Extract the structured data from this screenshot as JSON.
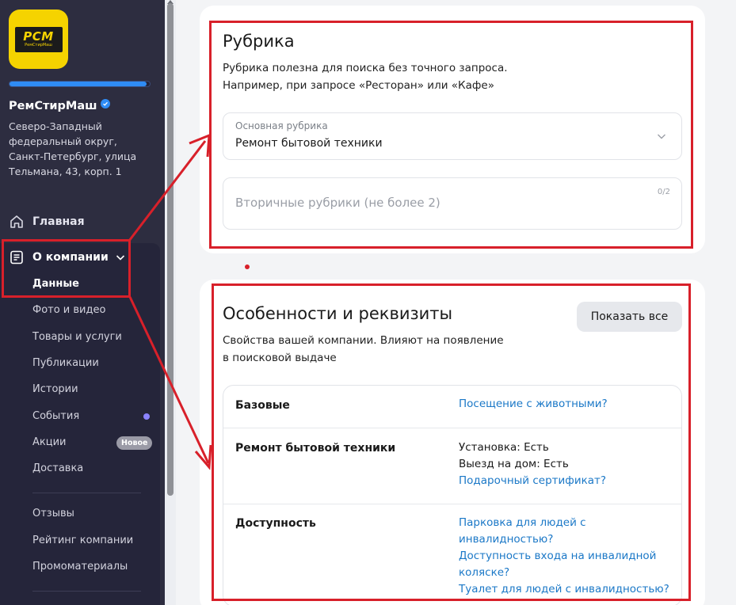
{
  "sidebar": {
    "logo": {
      "main": "РСМ",
      "sub": "РемСтирМаш"
    },
    "profile_progress": 0.98,
    "company_name": "РемСтирМаш",
    "address": "Северо-Западный федеральный округ, Санкт-Петербург, улица Тельмана, 43, корп. 1",
    "nav_main": "Главная",
    "nav_about": "О компании",
    "items": [
      {
        "label": "Данные"
      },
      {
        "label": "Фото и видео"
      },
      {
        "label": "Товары и услуги"
      },
      {
        "label": "Публикации"
      },
      {
        "label": "Истории"
      },
      {
        "label": "События"
      },
      {
        "label": "Акции"
      },
      {
        "label": "Доставка"
      },
      {
        "label": "Отзывы"
      },
      {
        "label": "Рейтинг компании"
      },
      {
        "label": "Промоматериалы"
      }
    ],
    "badge_new": "Новое"
  },
  "rubric": {
    "title": "Рубрика",
    "desc_line1": "Рубрика полезна для поиска без точного запроса.",
    "desc_line2": "Например, при запросе «Ресторан» или «Кафе»",
    "primary_label": "Основная рубрика",
    "primary_value": "Ремонт бытовой техники",
    "secondary_placeholder": "Вторичные рубрики (не более 2)",
    "secondary_count": "0/2"
  },
  "features": {
    "title": "Особенности и реквизиты",
    "desc_line1": "Свойства вашей компании. Влияют на появление",
    "desc_line2": "в поисковой выдаче",
    "show_all": "Показать все",
    "groups": [
      {
        "label": "Базовые",
        "link1": "Посещение с животными?"
      },
      {
        "label": "Ремонт бытовой техники",
        "value1": "Установка: Есть",
        "value2": "Выезд на дом: Есть",
        "link1": "Подарочный сертификат?"
      },
      {
        "label": "Доступность",
        "link1a": "Парковка для людей с",
        "link1b": "инвалидностью?",
        "link2a": "Доступность входа на инвалидной",
        "link2b": "коляске?",
        "link3": "Туалет для людей с инвалидностью?"
      }
    ]
  },
  "colors": {
    "sidebar_bg": "#2d2d40",
    "accent_blue": "#2f8cf5",
    "link": "#1b78c7",
    "annotation_red": "#d8202a",
    "logo_yellow": "#f5d300"
  }
}
